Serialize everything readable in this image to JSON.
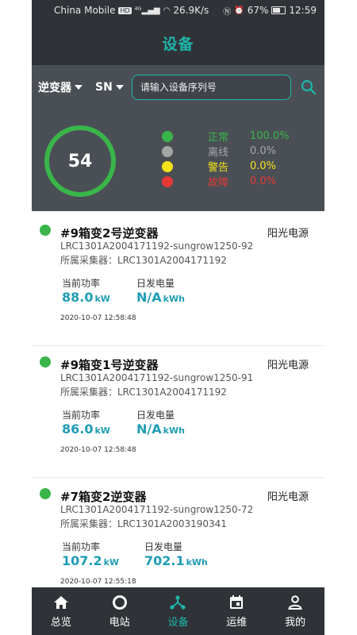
{
  "status_bar": {
    "carrier": "China Mobile",
    "network_badge": "HD",
    "signal": "4G",
    "speed": "26.9K/s",
    "battery": "67%",
    "time": "12:59"
  },
  "header": {
    "title": "设备"
  },
  "filters": {
    "type_label": "逆变器",
    "field_label": "SN",
    "search_placeholder": "请输入设备序列号"
  },
  "summary": {
    "total": "54",
    "ring_color": "#3ab54a",
    "items": [
      {
        "label": "正常",
        "value": "100.0%",
        "color": "#3ab54a"
      },
      {
        "label": "离线",
        "value": "0.0%",
        "color": "#a6a6a6"
      },
      {
        "label": "警告",
        "value": "0.0%",
        "color": "#f5e21b"
      },
      {
        "label": "故障",
        "value": "0.0%",
        "color": "#e53935"
      }
    ]
  },
  "devices": [
    {
      "name": "#9箱变2号逆变器",
      "brand": "阳光电源",
      "serial": "LRC1301A2004171192-sungrow1250-92",
      "collector": "所属采集器：LRC1301A2004171192",
      "power_label": "当前功率",
      "power_value": "88.0",
      "power_unit": "kW",
      "energy_label": "日发电量",
      "energy_value": "N/A",
      "energy_unit": "kWh",
      "time": "2020-10-07 12:58:48"
    },
    {
      "name": "#9箱变1号逆变器",
      "brand": "阳光电源",
      "serial": "LRC1301A2004171192-sungrow1250-91",
      "collector": "所属采集器：LRC1301A2004171192",
      "power_label": "当前功率",
      "power_value": "86.0",
      "power_unit": "kW",
      "energy_label": "日发电量",
      "energy_value": "N/A",
      "energy_unit": "kWh",
      "time": "2020-10-07 12:58:48"
    },
    {
      "name": "#7箱变2逆变器",
      "brand": "阳光电源",
      "serial": "LRC1301A2004171192-sungrow1250-72",
      "collector": "所属采集器：LRC1301A2003190341",
      "power_label": "当前功率",
      "power_value": "107.2",
      "power_unit": "kW",
      "energy_label": "日发电量",
      "energy_value": "702.1",
      "energy_unit": "kWh",
      "time": "2020-10-07 12:55:18"
    }
  ],
  "nav": [
    {
      "label": "总览",
      "icon": "home-icon"
    },
    {
      "label": "电站",
      "icon": "circle-icon"
    },
    {
      "label": "设备",
      "icon": "device-network-icon",
      "active": true
    },
    {
      "label": "运维",
      "icon": "calendar-icon"
    },
    {
      "label": "我的",
      "icon": "person-icon"
    }
  ],
  "colors": {
    "accent": "#1fb5a9",
    "dark_bg": "#2f3338",
    "panel_bg": "#4a4f55",
    "value_blue": "#1f9db5"
  }
}
